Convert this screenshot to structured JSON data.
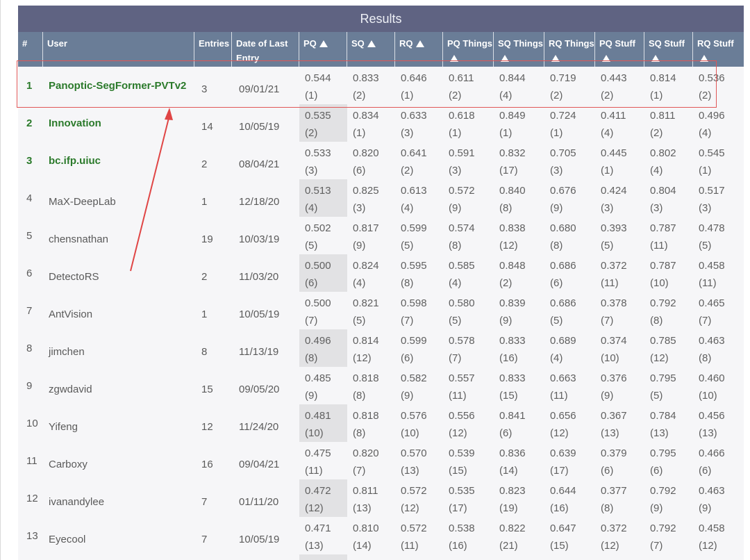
{
  "title": "Results",
  "columns": [
    {
      "label": "#",
      "sortable": false
    },
    {
      "label": "User",
      "sortable": false
    },
    {
      "label": "Entries",
      "sortable": false
    },
    {
      "label": "Date of Last Entry",
      "sortable": false
    },
    {
      "label": "PQ",
      "sortable": true
    },
    {
      "label": "SQ",
      "sortable": true
    },
    {
      "label": "RQ",
      "sortable": true
    },
    {
      "label": "PQ Things",
      "sortable": true
    },
    {
      "label": "SQ Things",
      "sortable": true
    },
    {
      "label": "RQ Things",
      "sortable": true
    },
    {
      "label": "PQ Stuff",
      "sortable": true
    },
    {
      "label": "SQ Stuff",
      "sortable": true
    },
    {
      "label": "RQ Stuff",
      "sortable": true
    }
  ],
  "rows": [
    {
      "rank": "1",
      "user": "Panoptic-SegFormer-PVTv2",
      "entries": "3",
      "date": "09/01/21",
      "highlight": true,
      "metrics": [
        [
          "0.544",
          "(1)"
        ],
        [
          "0.833",
          "(2)"
        ],
        [
          "0.646",
          "(1)"
        ],
        [
          "0.611",
          "(2)"
        ],
        [
          "0.844",
          "(4)"
        ],
        [
          "0.719",
          "(2)"
        ],
        [
          "0.443",
          "(2)"
        ],
        [
          "0.814",
          "(1)"
        ],
        [
          "0.536",
          "(2)"
        ]
      ]
    },
    {
      "rank": "2",
      "user": "Innovation",
      "entries": "14",
      "date": "10/05/19",
      "highlight": true,
      "metrics": [
        [
          "0.535",
          "(2)"
        ],
        [
          "0.834",
          "(1)"
        ],
        [
          "0.633",
          "(3)"
        ],
        [
          "0.618",
          "(1)"
        ],
        [
          "0.849",
          "(1)"
        ],
        [
          "0.724",
          "(1)"
        ],
        [
          "0.411",
          "(4)"
        ],
        [
          "0.811",
          "(2)"
        ],
        [
          "0.496",
          "(4)"
        ]
      ]
    },
    {
      "rank": "3",
      "user": "bc.ifp.uiuc",
      "entries": "2",
      "date": "08/04/21",
      "highlight": true,
      "metrics": [
        [
          "0.533",
          "(3)"
        ],
        [
          "0.820",
          "(6)"
        ],
        [
          "0.641",
          "(2)"
        ],
        [
          "0.591",
          "(3)"
        ],
        [
          "0.832",
          "(17)"
        ],
        [
          "0.705",
          "(3)"
        ],
        [
          "0.445",
          "(1)"
        ],
        [
          "0.802",
          "(4)"
        ],
        [
          "0.545",
          "(1)"
        ]
      ]
    },
    {
      "rank": "4",
      "user": "MaX-DeepLab",
      "entries": "1",
      "date": "12/18/20",
      "highlight": false,
      "metrics": [
        [
          "0.513",
          "(4)"
        ],
        [
          "0.825",
          "(3)"
        ],
        [
          "0.613",
          "(4)"
        ],
        [
          "0.572",
          "(9)"
        ],
        [
          "0.840",
          "(8)"
        ],
        [
          "0.676",
          "(9)"
        ],
        [
          "0.424",
          "(3)"
        ],
        [
          "0.804",
          "(3)"
        ],
        [
          "0.517",
          "(3)"
        ]
      ]
    },
    {
      "rank": "5",
      "user": "chensnathan",
      "entries": "19",
      "date": "10/03/19",
      "highlight": false,
      "metrics": [
        [
          "0.502",
          "(5)"
        ],
        [
          "0.817",
          "(9)"
        ],
        [
          "0.599",
          "(5)"
        ],
        [
          "0.574",
          "(8)"
        ],
        [
          "0.838",
          "(12)"
        ],
        [
          "0.680",
          "(8)"
        ],
        [
          "0.393",
          "(5)"
        ],
        [
          "0.787",
          "(11)"
        ],
        [
          "0.478",
          "(5)"
        ]
      ]
    },
    {
      "rank": "6",
      "user": "DetectoRS",
      "entries": "2",
      "date": "11/03/20",
      "highlight": false,
      "metrics": [
        [
          "0.500",
          "(6)"
        ],
        [
          "0.824",
          "(4)"
        ],
        [
          "0.595",
          "(8)"
        ],
        [
          "0.585",
          "(4)"
        ],
        [
          "0.848",
          "(2)"
        ],
        [
          "0.686",
          "(6)"
        ],
        [
          "0.372",
          "(11)"
        ],
        [
          "0.787",
          "(10)"
        ],
        [
          "0.458",
          "(11)"
        ]
      ]
    },
    {
      "rank": "7",
      "user": "AntVision",
      "entries": "1",
      "date": "10/05/19",
      "highlight": false,
      "metrics": [
        [
          "0.500",
          "(7)"
        ],
        [
          "0.821",
          "(5)"
        ],
        [
          "0.598",
          "(7)"
        ],
        [
          "0.580",
          "(5)"
        ],
        [
          "0.839",
          "(9)"
        ],
        [
          "0.686",
          "(5)"
        ],
        [
          "0.378",
          "(7)"
        ],
        [
          "0.792",
          "(8)"
        ],
        [
          "0.465",
          "(7)"
        ]
      ]
    },
    {
      "rank": "8",
      "user": "jimchen",
      "entries": "8",
      "date": "11/13/19",
      "highlight": false,
      "metrics": [
        [
          "0.496",
          "(8)"
        ],
        [
          "0.814",
          "(12)"
        ],
        [
          "0.599",
          "(6)"
        ],
        [
          "0.578",
          "(7)"
        ],
        [
          "0.833",
          "(16)"
        ],
        [
          "0.689",
          "(4)"
        ],
        [
          "0.374",
          "(10)"
        ],
        [
          "0.785",
          "(12)"
        ],
        [
          "0.463",
          "(8)"
        ]
      ]
    },
    {
      "rank": "9",
      "user": "zgwdavid",
      "entries": "15",
      "date": "09/05/20",
      "highlight": false,
      "metrics": [
        [
          "0.485",
          "(9)"
        ],
        [
          "0.818",
          "(8)"
        ],
        [
          "0.582",
          "(9)"
        ],
        [
          "0.557",
          "(11)"
        ],
        [
          "0.833",
          "(15)"
        ],
        [
          "0.663",
          "(11)"
        ],
        [
          "0.376",
          "(9)"
        ],
        [
          "0.795",
          "(5)"
        ],
        [
          "0.460",
          "(10)"
        ]
      ]
    },
    {
      "rank": "10",
      "user": "Yifeng",
      "entries": "12",
      "date": "11/24/20",
      "highlight": false,
      "metrics": [
        [
          "0.481",
          "(10)"
        ],
        [
          "0.818",
          "(8)"
        ],
        [
          "0.576",
          "(10)"
        ],
        [
          "0.556",
          "(12)"
        ],
        [
          "0.841",
          "(6)"
        ],
        [
          "0.656",
          "(12)"
        ],
        [
          "0.367",
          "(13)"
        ],
        [
          "0.784",
          "(13)"
        ],
        [
          "0.456",
          "(13)"
        ]
      ]
    },
    {
      "rank": "11",
      "user": "Carboxy",
      "entries": "16",
      "date": "09/04/21",
      "highlight": false,
      "metrics": [
        [
          "0.475",
          "(11)"
        ],
        [
          "0.820",
          "(7)"
        ],
        [
          "0.570",
          "(13)"
        ],
        [
          "0.539",
          "(15)"
        ],
        [
          "0.836",
          "(14)"
        ],
        [
          "0.639",
          "(17)"
        ],
        [
          "0.379",
          "(6)"
        ],
        [
          "0.795",
          "(6)"
        ],
        [
          "0.466",
          "(6)"
        ]
      ]
    },
    {
      "rank": "12",
      "user": "ivanandylee",
      "entries": "7",
      "date": "01/11/20",
      "highlight": false,
      "metrics": [
        [
          "0.472",
          "(12)"
        ],
        [
          "0.811",
          "(13)"
        ],
        [
          "0.572",
          "(12)"
        ],
        [
          "0.535",
          "(17)"
        ],
        [
          "0.823",
          "(19)"
        ],
        [
          "0.644",
          "(16)"
        ],
        [
          "0.377",
          "(8)"
        ],
        [
          "0.792",
          "(9)"
        ],
        [
          "0.463",
          "(9)"
        ]
      ]
    },
    {
      "rank": "13",
      "user": "Eyecool",
      "entries": "7",
      "date": "10/05/19",
      "highlight": false,
      "metrics": [
        [
          "0.471",
          "(13)"
        ],
        [
          "0.810",
          "(14)"
        ],
        [
          "0.572",
          "(11)"
        ],
        [
          "0.538",
          "(16)"
        ],
        [
          "0.822",
          "(21)"
        ],
        [
          "0.647",
          "(15)"
        ],
        [
          "0.372",
          "(12)"
        ],
        [
          "0.792",
          "(7)"
        ],
        [
          "0.458",
          "(12)"
        ]
      ]
    }
  ],
  "colors": {
    "title_bar": "#5f6382",
    "header": "#6a7d97",
    "top_user": "#2b7a2b",
    "highlight_box": "#e05656",
    "pq_shade": "#e2e2e4"
  }
}
